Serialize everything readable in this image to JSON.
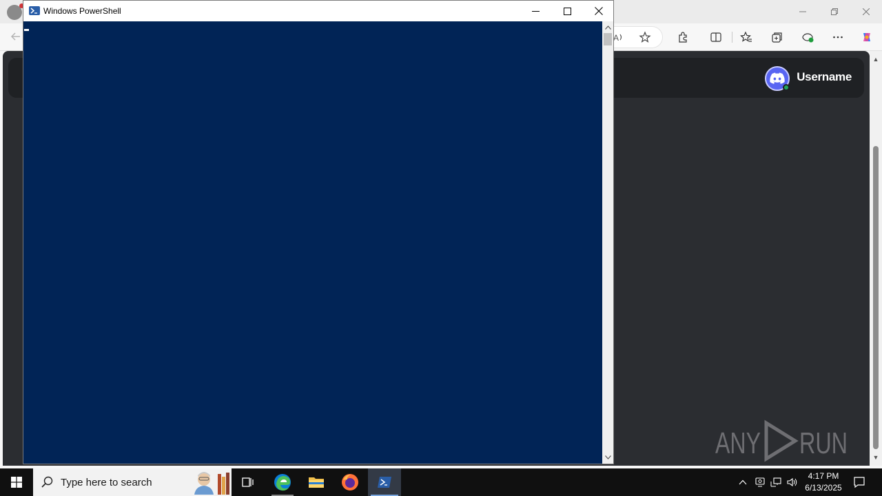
{
  "powershell": {
    "title": "Windows PowerShell",
    "console_bg": "#012456"
  },
  "browser": {
    "discord": {
      "username": "Username",
      "status_color": "#23a55a",
      "brand_color": "#5865f2"
    },
    "watermark": "ANY RUN"
  },
  "taskbar": {
    "search_placeholder": "Type here to search",
    "apps": [
      "task-view",
      "edge",
      "file-explorer",
      "firefox",
      "powershell"
    ],
    "clock": {
      "time": "4:17 PM",
      "date": "6/13/2025"
    }
  }
}
